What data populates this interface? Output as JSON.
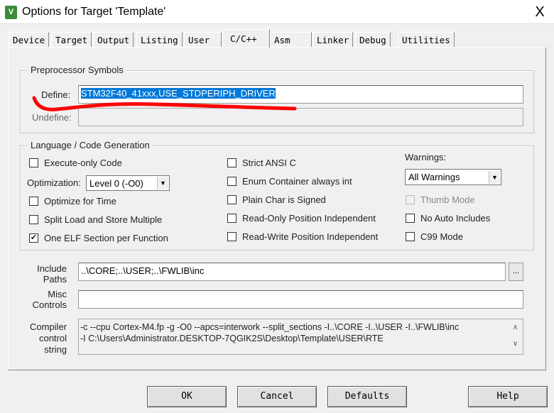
{
  "window": {
    "title": "Options for Target 'Template'",
    "close": "X",
    "icon": "keil-uvision-icon"
  },
  "tabs": [
    "Device",
    "Target",
    "Output",
    "Listing",
    "User",
    "C/C++",
    "Asm",
    "Linker",
    "Debug",
    "Utilities"
  ],
  "active_tab": "C/C++",
  "preprocessor": {
    "group": "Preprocessor Symbols",
    "define_label": "Define:",
    "define_value": "STM32F40_41xxx,USE_STDPERIPH_DRIVER",
    "undefine_label": "Undefine:",
    "undefine_value": ""
  },
  "codegen": {
    "group": "Language / Code Generation",
    "execute_only": {
      "label": "Execute-only Code",
      "checked": false
    },
    "optimization_label": "Optimization:",
    "optimization_value": "Level 0 (-O0)",
    "optimize_time": {
      "label": "Optimize for Time",
      "checked": false
    },
    "split_load": {
      "label": "Split Load and Store Multiple",
      "checked": false
    },
    "one_elf": {
      "label": "One ELF Section per Function",
      "checked": true
    },
    "strict_ansi": {
      "label": "Strict ANSI C",
      "checked": false
    },
    "enum_int": {
      "label": "Enum Container always int",
      "checked": false
    },
    "plain_char": {
      "label": "Plain Char is Signed",
      "checked": false
    },
    "ropi": {
      "label": "Read-Only Position Independent",
      "checked": false
    },
    "rwpi": {
      "label": "Read-Write Position Independent",
      "checked": false
    },
    "warnings_label": "Warnings:",
    "warnings_value": "All Warnings",
    "thumb": {
      "label": "Thumb Mode",
      "checked": false,
      "disabled": true
    },
    "no_auto": {
      "label": "No Auto Includes",
      "checked": false
    },
    "c99": {
      "label": "C99 Mode",
      "checked": false
    }
  },
  "include": {
    "label1": "Include",
    "label2": "Paths",
    "value": "..\\CORE;..\\USER;..\\FWLIB\\inc",
    "browse": "..."
  },
  "misc": {
    "label1": "Misc",
    "label2": "Controls",
    "value": ""
  },
  "compiler": {
    "label1": "Compiler",
    "label2": "control",
    "label3": "string",
    "line1": "-c --cpu Cortex-M4.fp -g -O0 --apcs=interwork --split_sections -I..\\CORE -I..\\USER -I..\\FWLIB\\inc",
    "line2": "-I C:\\Users\\Administrator.DESKTOP-7QGIK2S\\Desktop\\Template\\USER\\RTE"
  },
  "buttons": {
    "ok": "OK",
    "cancel": "Cancel",
    "defaults": "Defaults",
    "help": "Help"
  },
  "annotation_color": "#ff0000"
}
